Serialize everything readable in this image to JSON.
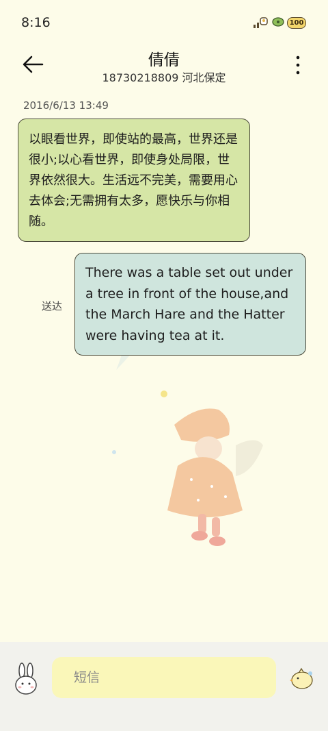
{
  "status": {
    "time": "8:16",
    "battery": "100"
  },
  "header": {
    "contact_name": "倩倩",
    "contact_sub": "18730218809 河北保定"
  },
  "conversation": {
    "timestamp": "2016/6/13 13:49",
    "messages": [
      {
        "direction": "incoming",
        "text": "以眼看世界，即使站的最高，世界还是很小;以心看世界，即使身处局限，世界依然很大。生活远不完美，需要用心去体会;无需拥有太多，愿快乐与你相随。"
      },
      {
        "direction": "outgoing",
        "text": "There was a table set out under a tree in front of the house,and the March Hare and the Hatter were having tea at it.",
        "status": "送达"
      }
    ]
  },
  "composer": {
    "placeholder": "短信"
  },
  "colors": {
    "background": "#FDFCE9",
    "incoming_bubble": "#D6E6A6",
    "outgoing_bubble": "#CFE5DD",
    "input": "#FAF7B9"
  }
}
